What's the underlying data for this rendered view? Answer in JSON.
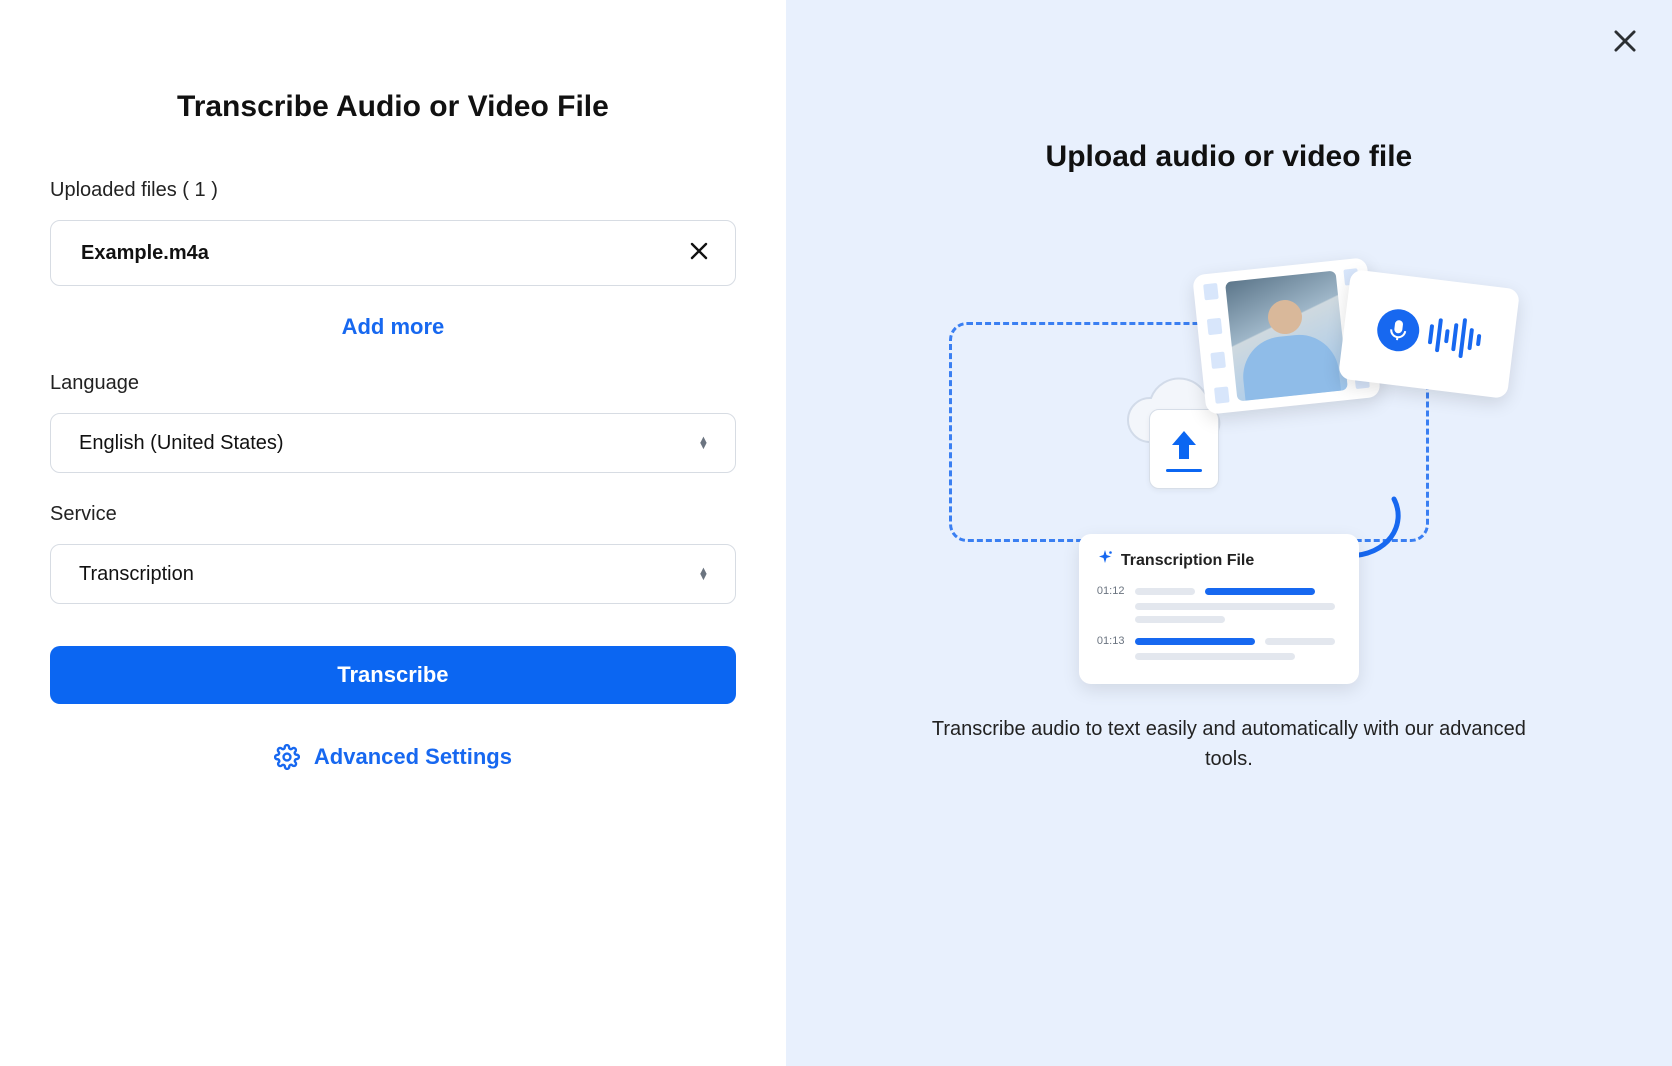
{
  "left": {
    "title": "Transcribe Audio or Video File",
    "uploaded_label_prefix": "Uploaded files ( ",
    "uploaded_count": "1",
    "uploaded_label_suffix": " )",
    "file_name": "Example.m4a",
    "add_more": "Add more",
    "language_label": "Language",
    "language_value": "English (United States)",
    "service_label": "Service",
    "service_value": "Transcription",
    "transcribe_button": "Transcribe",
    "advanced_settings": "Advanced Settings"
  },
  "right": {
    "title": "Upload audio or video file",
    "trans_card_title": "Transcription File",
    "time1": "01:12",
    "time2": "01:13",
    "subtitle": "Transcribe audio to text easily and automatically with our advanced tools."
  }
}
